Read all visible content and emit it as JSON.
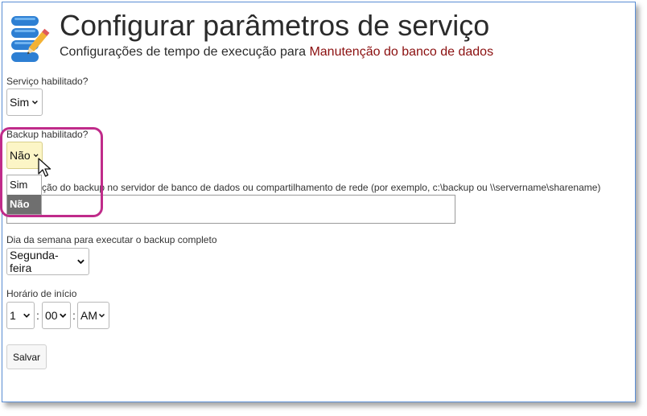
{
  "header": {
    "title": "Configurar parâmetros de serviço",
    "subtitle_prefix": "Configurações de tempo de execução para",
    "service_name": "Manutenção do banco de dados",
    "icon": "database-edit-icon"
  },
  "form": {
    "service_enabled": {
      "label": "Serviço habilitado?",
      "value": "Sim"
    },
    "backup_enabled": {
      "label": "Backup habilitado?",
      "value": "Não",
      "options": [
        "Sim",
        "Não"
      ],
      "highlighted_option": "Não"
    },
    "backup_location": {
      "label_visible": "ção do backup no servidor de banco de dados ou compartilhamento de rede (por exemplo, c:\\backup ou \\\\servername\\sharename)",
      "value": ""
    },
    "full_backup_day": {
      "label": "Dia da semana para executar o backup completo",
      "value": "Segunda-feira"
    },
    "start_time": {
      "label": "Horário de início",
      "hour": "1",
      "minute": "00",
      "ampm": "AM",
      "separator": ":"
    },
    "save_label": "Salvar"
  },
  "colors": {
    "accent_service_name": "#8b1010",
    "callout": "#c02b8a",
    "highlight_select": "#fcf5c6",
    "selected_option": "#6f6f6f"
  }
}
